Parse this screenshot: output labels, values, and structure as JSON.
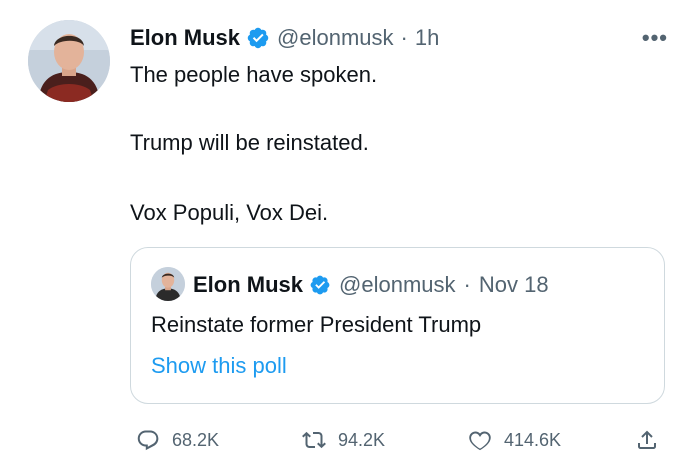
{
  "tweet": {
    "author_name": "Elon Musk",
    "author_handle": "@elonmusk",
    "time": "1h",
    "separator": "·",
    "more_label": "•••",
    "lines": [
      "The people have spoken.",
      "Trump will be reinstated.",
      "Vox Populi, Vox Dei."
    ],
    "avatar_icon": "person-avatar"
  },
  "quoted_tweet": {
    "author_name": "Elon Musk",
    "author_handle": "@elonmusk",
    "separator": "·",
    "date": "Nov 18",
    "text": "Reinstate former President Trump",
    "link_text": "Show this poll"
  },
  "actions": {
    "reply_count": "68.2K",
    "retweet_count": "94.2K",
    "like_count": "414.6K",
    "share_icon": "share-icon"
  },
  "colors": {
    "verified": "#1d9bf0",
    "link": "#1d9bf0",
    "muted": "#536471",
    "border": "#cfd9de",
    "text": "#0f1419"
  }
}
